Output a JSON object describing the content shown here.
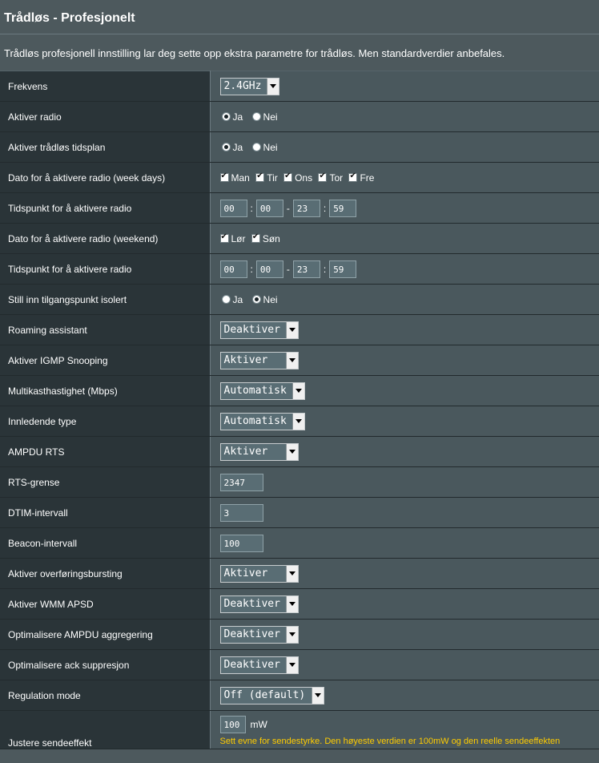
{
  "page": {
    "title": "Trådløs - Profesjonelt",
    "description": "Trådløs profesjonell innstilling lar deg sette opp ekstra parametre for trådløs. Men standardverdier anbefales."
  },
  "rows": {
    "frekvens": {
      "label": "Frekvens",
      "value": "2.4GHz"
    },
    "aktiver_radio": {
      "label": "Aktiver radio",
      "yes": "Ja",
      "no": "Nei",
      "selected": "Ja"
    },
    "tidsplan": {
      "label": "Aktiver trådløs tidsplan",
      "yes": "Ja",
      "no": "Nei",
      "selected": "Ja"
    },
    "dato_week": {
      "label": "Dato for å aktivere radio (week days)",
      "days": [
        "Man",
        "Tir",
        "Ons",
        "Tor",
        "Fre"
      ]
    },
    "tid_week": {
      "label": "Tidspunkt for å aktivere radio",
      "h1": "00",
      "m1": "00",
      "h2": "23",
      "m2": "59"
    },
    "dato_weekend": {
      "label": "Dato for å aktivere radio (weekend)",
      "days": [
        "Lør",
        "Søn"
      ]
    },
    "tid_weekend": {
      "label": "Tidspunkt for å aktivere radio",
      "h1": "00",
      "m1": "00",
      "h2": "23",
      "m2": "59"
    },
    "isolert": {
      "label": "Still inn tilgangspunkt isolert",
      "yes": "Ja",
      "no": "Nei",
      "selected": "Nei"
    },
    "roaming": {
      "label": "Roaming assistant",
      "value": "Deaktiver"
    },
    "igmp": {
      "label": "Aktiver IGMP Snooping",
      "value": "Aktiver"
    },
    "multicast": {
      "label": "Multikasthastighet (Mbps)",
      "value": "Automatisk"
    },
    "preamble": {
      "label": "Innledende type",
      "value": "Automatisk"
    },
    "ampdu_rts": {
      "label": "AMPDU RTS",
      "value": "Aktiver"
    },
    "rts": {
      "label": "RTS-grense",
      "value": "2347"
    },
    "dtim": {
      "label": "DTIM-intervall",
      "value": "3"
    },
    "beacon": {
      "label": "Beacon-intervall",
      "value": "100"
    },
    "bursting": {
      "label": "Aktiver overføringsbursting",
      "value": "Aktiver"
    },
    "wmm_apsd": {
      "label": "Aktiver WMM APSD",
      "value": "Deaktiver"
    },
    "ampdu_agg": {
      "label": "Optimalisere AMPDU aggregering",
      "value": "Deaktiver"
    },
    "ack": {
      "label": "Optimalisere ack suppresjon",
      "value": "Deaktiver"
    },
    "regulation": {
      "label": "Regulation mode",
      "value": "Off (default)"
    },
    "txpower": {
      "label": "Justere sendeeffekt",
      "value": "100",
      "unit": "mW",
      "note": "Sett evne for sendestyrke. Den høyeste verdien er 100mW og den reelle sendeeffekten"
    }
  }
}
